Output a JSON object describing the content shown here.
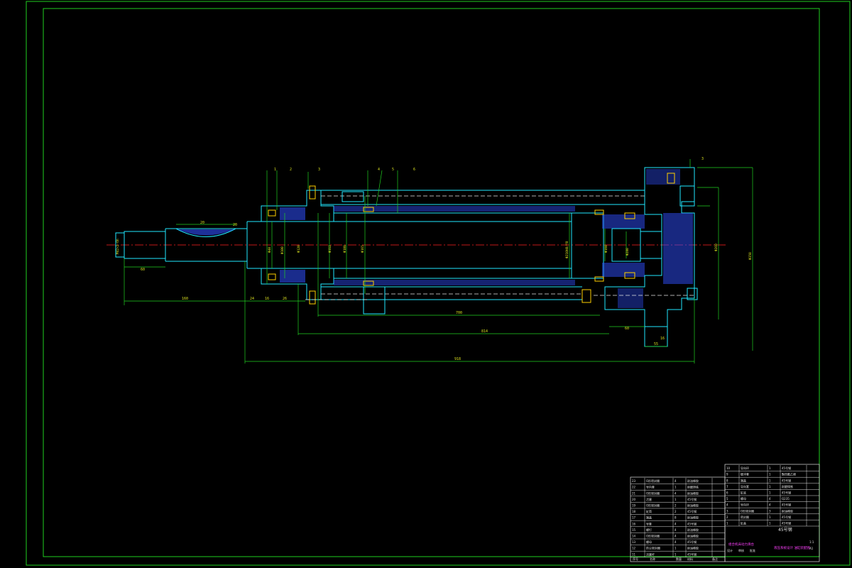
{
  "colors": {
    "background": "#000000",
    "frame": "#20d020",
    "outline": "#20e8ff",
    "hidden": "#e8e8e8",
    "hatch": "#3050ff",
    "centerline": "#ff2020",
    "dimension": "#20d020",
    "dimension_text": "#d8e020",
    "leader": "#ffd000",
    "titleblock": "#e0e0e0",
    "highlight": "#ff40ff"
  },
  "balloons": [
    "1",
    "2",
    "3",
    "4",
    "5",
    "6",
    "3"
  ],
  "dimensions": {
    "shaft_length": "60",
    "thread_len": "20",
    "chamfer": "20",
    "rod_ext": "160",
    "d1": "24",
    "d2": "16",
    "d3": "26",
    "stroke": "700",
    "inner_len": "814",
    "total_len": "918",
    "base_w": "60",
    "foot_w": "55",
    "foot_h": "16",
    "height": "620",
    "shaft_dia": "M42×2-6h",
    "dia_rod": "Φ40",
    "dia_a": "Φ100",
    "dia_b": "Φ120",
    "dia_c": "Φ112",
    "dia_d": "Φ100",
    "dia_bore": "Φ210H8/f8",
    "dia_e": "Φ165",
    "dia_f": "Φ160",
    "dia_g": "Φ280",
    "dia_h": "Φ260",
    "dia_i": "Φ350"
  },
  "titleblock": {
    "left_rows": [
      {
        "no": "23",
        "name": "O形密封圈",
        "qty": "4",
        "mat": "耐油橡胶"
      },
      {
        "no": "22",
        "name": "导向套",
        "qty": "1",
        "mat": "耐磨铸铁"
      },
      {
        "no": "21",
        "name": "O形密封圈",
        "qty": "4",
        "mat": "耐油橡胶"
      },
      {
        "no": "20",
        "name": "活塞",
        "qty": "1",
        "mat": "45号钢"
      },
      {
        "no": "19",
        "name": "O形密封圈",
        "qty": "2",
        "mat": "耐油橡胶"
      },
      {
        "no": "18",
        "name": "缸筒",
        "qty": "2",
        "mat": "45号钢"
      },
      {
        "no": "17",
        "name": "端盖",
        "qty": "8",
        "mat": "耐油橡胶"
      },
      {
        "no": "16",
        "name": "导套",
        "qty": "4",
        "mat": "45号钢"
      },
      {
        "no": "15",
        "name": "螺钉",
        "qty": "4",
        "mat": "耐油橡胶"
      },
      {
        "no": "14",
        "name": "O形密封圈",
        "qty": "4",
        "mat": "耐油橡胶"
      },
      {
        "no": "13",
        "name": "螺母",
        "qty": "4",
        "mat": "45号钢"
      },
      {
        "no": "12",
        "name": "防尘密封圈",
        "qty": "1",
        "mat": "耐油橡胶"
      },
      {
        "no": "11",
        "name": "活塞杆",
        "qty": "1",
        "mat": "45号钢"
      }
    ],
    "right_rows": [
      {
        "no": "10",
        "name": "导向环",
        "qty": "1",
        "mat": "45号钢"
      },
      {
        "no": "9",
        "name": "缓冲套",
        "qty": "1",
        "mat": "聚四氟乙烯"
      },
      {
        "no": "8",
        "name": "端盖",
        "qty": "1",
        "mat": "45号钢"
      },
      {
        "no": "7",
        "name": "导向套",
        "qty": "1",
        "mat": "耐磨铸铁"
      },
      {
        "no": "6",
        "name": "缸底",
        "qty": "1",
        "mat": "45号钢"
      },
      {
        "no": "5",
        "name": "螺母",
        "qty": "4",
        "mat": "Q235"
      },
      {
        "no": "4",
        "name": "导向环",
        "qty": "4",
        "mat": "45号钢"
      },
      {
        "no": "3",
        "name": "O形密封圈",
        "qty": "3",
        "mat": "耐油橡胶"
      },
      {
        "no": "2",
        "name": "密封圈",
        "qty": "1",
        "mat": "45号钢"
      },
      {
        "no": "1",
        "name": "缸盖",
        "qty": "1",
        "mat": "45号钢"
      }
    ],
    "header": {
      "no": "序号",
      "name": "名称",
      "qty": "数量",
      "mat": "材料",
      "note": "备注"
    },
    "material_big": "45号钢",
    "drawing_title": "组合机床动力滑台",
    "project_title": "液压系统设计 油缸装配图",
    "sign_design": "设计",
    "sign_check": "审核",
    "sign_approve": "批准",
    "scale": "1:1",
    "sheet": "A1"
  }
}
